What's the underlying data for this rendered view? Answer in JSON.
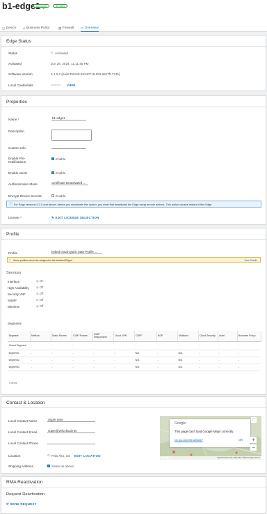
{
  "header": {
    "title": "b1-edge1",
    "badges": [
      "Connected",
      "SD-WAN"
    ]
  },
  "tabs": [
    {
      "label": "Device",
      "icon": "device-icon"
    },
    {
      "label": "Business Policy",
      "icon": "policy-icon"
    },
    {
      "label": "Firewall",
      "icon": "firewall-icon"
    },
    {
      "label": "Overview",
      "icon": "overview-icon"
    }
  ],
  "edge_status": {
    "title": "Edge Status",
    "status_label": "Status",
    "status_value": "Activated",
    "activated_label": "Activated",
    "activated_value": "Jun 28, 2024, 11:11:45 PM",
    "software_label": "Software Version",
    "software_value": "6.1.0.0 (build R6100-20240719-MN-9647f1774b)",
    "credentials_label": "Local Credentials",
    "credentials_value": "••••••••••",
    "view_link": "VIEW"
  },
  "properties": {
    "title": "Properties",
    "name_label": "Name *",
    "name_value": "b1-edge1",
    "description_label": "Description",
    "custom_info_label": "Custom Info",
    "pre_notif_label": "Enable Pre-Notifications",
    "pre_notif_value": "Enable",
    "alerts_label": "Enable Alerts",
    "alerts_value": "Enable",
    "auth_mode_label": "Authentication Mode",
    "auth_mode_value": "Certificate Deactivated",
    "encrypt_label": "Encrypt Device Secrets",
    "encrypt_value": "Enable",
    "info_text": "For Edge versions 5.2.0 and above, before you deactivate this option, you must first deactivate the Edge using remote actions. This action causes restart of this Edge.",
    "license_label": "License *",
    "license_link": "EDIT LICENSE SELECTION"
  },
  "profile": {
    "title": "Profile",
    "profile_label": "Profile",
    "profile_value": "hybrid-cloud-Quick Start Profile",
    "warning_text": "Some profiles cannot be assigned to the selected Edges.",
    "warning_link": "View Details",
    "services_title": "Services",
    "services": [
      {
        "label": "Interface",
        "state": "On"
      },
      {
        "label": "High Availability",
        "state": "Off"
      },
      {
        "label": "Security VNF",
        "state": "Off"
      },
      {
        "label": "SNMP",
        "state": "Off"
      },
      {
        "label": "Wireless",
        "state": "Off"
      }
    ],
    "segments_title": "Segments",
    "segment_headers": [
      "Segment",
      "Netflow",
      "Static Routes",
      "ICMP Probes",
      "ICMP Responders",
      "Cloud VPN",
      "OSPF",
      "BGP",
      "Multicast",
      "Cloud Security",
      "AuthI",
      "Business Policy"
    ],
    "segment_rows": [
      [
        "Global Segment",
        "-",
        "-",
        "-",
        "-",
        "-",
        "-",
        "-",
        "-",
        "-",
        "-",
        "-"
      ],
      [
        "segment1",
        "-",
        "-",
        "-",
        "-",
        "-",
        "N/A",
        "-",
        "N/A",
        "-",
        "-",
        "-"
      ],
      [
        "segment2",
        "-",
        "-",
        "-",
        "-",
        "-",
        "N/A",
        "-",
        "N/A",
        "-",
        "-",
        "-"
      ],
      [
        "segment3",
        "-",
        "-",
        "-",
        "-",
        "-",
        "N/A",
        "-",
        "N/A",
        "-",
        "-",
        "-"
      ]
    ],
    "items_count": "4 items"
  },
  "contact": {
    "title": "Contact & Location",
    "name_label": "Local Contact Name",
    "name_value": "Super User",
    "email_label": "Local Contact Email",
    "email_value": "super@velocloud.net",
    "phone_label": "Local Contact Phone",
    "phone_value": "",
    "location_label": "Location",
    "location_value": "Palo Alto, US",
    "location_link": "EDIT LOCATION",
    "shipping_label": "Shipping Address",
    "shipping_value": "Same as above",
    "map": {
      "brand": "Google",
      "message": "This page can't load Google Maps correctly.",
      "question": "Do you own this website?",
      "ok_label": "OK",
      "footer": "Keyboard shortcuts | Map data ©2024 Google | Terms"
    }
  },
  "rma": {
    "title": "RMA Reactivation",
    "request_title": "Request Reactivation",
    "send_link": "SEND REQUEST"
  }
}
